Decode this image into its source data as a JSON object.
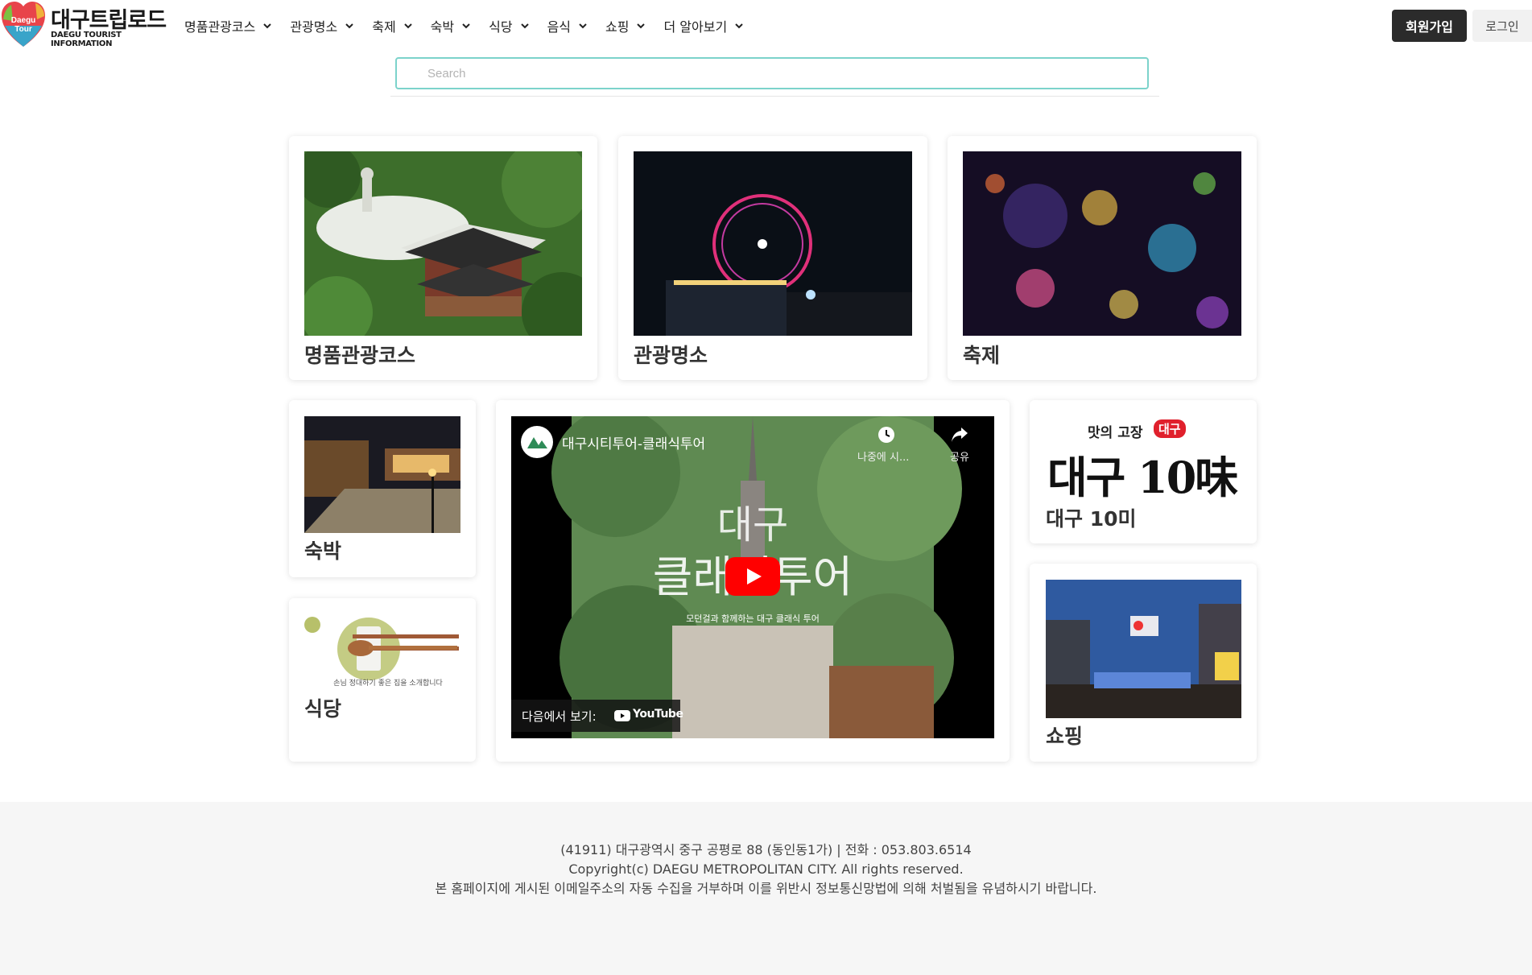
{
  "header": {
    "logo_badge": "Daegu Tour",
    "logo_title": "대구트립로드",
    "logo_subtitle": "DAEGU TOURIST INFORMATION",
    "nav": [
      {
        "label": "명품관광코스"
      },
      {
        "label": "관광명소"
      },
      {
        "label": "축제"
      },
      {
        "label": "숙박"
      },
      {
        "label": "식당"
      },
      {
        "label": "음식"
      },
      {
        "label": "쇼핑"
      },
      {
        "label": "더 알아보기"
      }
    ],
    "join_label": "회원가입",
    "login_label": "로그인"
  },
  "search": {
    "placeholder": "Search",
    "value": ""
  },
  "cards": {
    "course": "명품관광코스",
    "attractions": "관광명소",
    "festival": "축제",
    "lodging": "숙박",
    "restaurant": "식당",
    "food10": "대구 10미",
    "shopping": "쇼핑"
  },
  "food10_banner": {
    "top": "맛의 고장",
    "badge": "대구",
    "main": "대구 10味"
  },
  "restaurant_tagline": "손님 정대하기 좋은 집을 소개합니다",
  "video": {
    "channel_title": "대구시티투어-클래식투어",
    "watch_later": "나중에 시...",
    "share": "공유",
    "overlay_line1": "대구",
    "overlay_line2": "클래식투어",
    "overlay_sub": "모던걸과 함께하는 대구 클래식 투어",
    "watch_on": "다음에서 보기:",
    "youtube": "YouTube"
  },
  "footer": {
    "address": "(41911) 대구광역시 중구 공평로 88 (동인동1가) | 전화 : 053.803.6514",
    "copyright": "Copyright(c) DAEGU METROPOLITAN CITY. All rights reserved.",
    "notice": "본 홈페이지에 게시된 이메일주소의 자동 수집을 거부하며 이를 위반시 정보통신망법에 의해 처벌됨을 유념하시기 바랍니다."
  },
  "colors": {
    "accent_search_border": "#7cd3cb",
    "join_button_bg": "#2b2b2b",
    "youtube_red": "#ff0000",
    "footer_bg": "#f6f6f6"
  }
}
